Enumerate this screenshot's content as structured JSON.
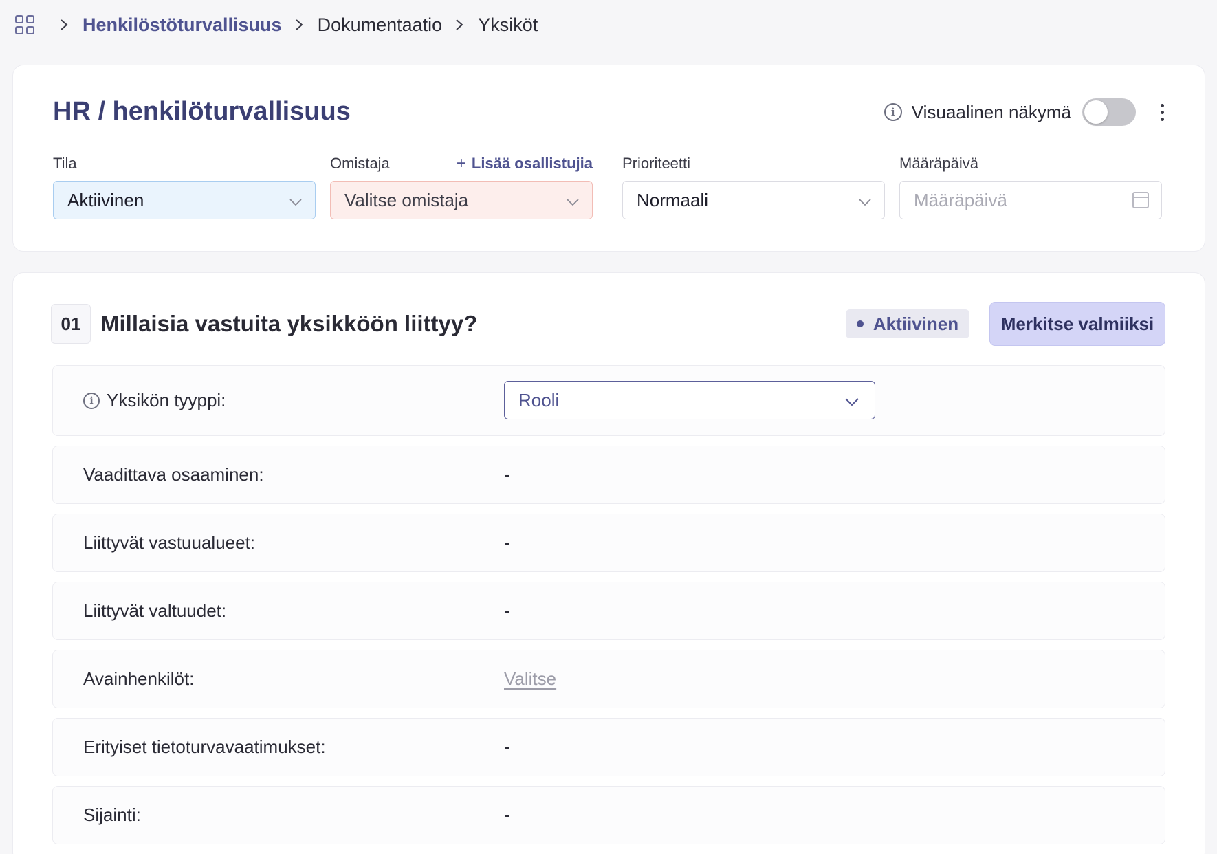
{
  "breadcrumb": {
    "items": [
      "Henkilöstöturvallisuus",
      "Dokumentaatio",
      "Yksiköt"
    ]
  },
  "header": {
    "title": "HR / henkilöturvallisuus",
    "visual_view_label": "Visuaalinen näkymä",
    "visual_view_enabled": false
  },
  "fields": {
    "status": {
      "label": "Tila",
      "value": "Aktiivinen"
    },
    "owner": {
      "label": "Omistaja",
      "placeholder": "Valitse omistaja",
      "add_participants": "Lisää osallistujia"
    },
    "priority": {
      "label": "Prioriteetti",
      "value": "Normaali"
    },
    "due_date": {
      "label": "Määräpäivä",
      "placeholder": "Määräpäivä"
    }
  },
  "question": {
    "number": "01",
    "title": "Millaisia vastuita yksikköön liittyy?",
    "status": "Aktiivinen",
    "complete_button": "Merkitse valmiiksi"
  },
  "rows": [
    {
      "label": "Yksikön tyyppi:",
      "value": "Rooli"
    },
    {
      "label": "Vaadittava osaaminen:",
      "value": "-"
    },
    {
      "label": "Liittyvät vastuualueet:",
      "value": "-"
    },
    {
      "label": "Liittyvät valtuudet:",
      "value": "-"
    },
    {
      "label": "Avainhenkilöt:",
      "value": "Valitse"
    },
    {
      "label": "Erityiset tietoturvavaatimukset:",
      "value": "-"
    },
    {
      "label": "Sijainti:",
      "value": "-"
    }
  ],
  "colors": {
    "accent": "#4f5390",
    "title": "#3b3f73",
    "status_bg": "#eaf4fd",
    "owner_bg": "#fdeeec",
    "complete_button_bg": "#d4d5f7"
  },
  "icons": [
    "apps-grid-icon",
    "chevron-right-icon",
    "info-icon",
    "kebab-menu-icon",
    "chevron-down-icon",
    "calendar-icon",
    "plus-icon"
  ]
}
